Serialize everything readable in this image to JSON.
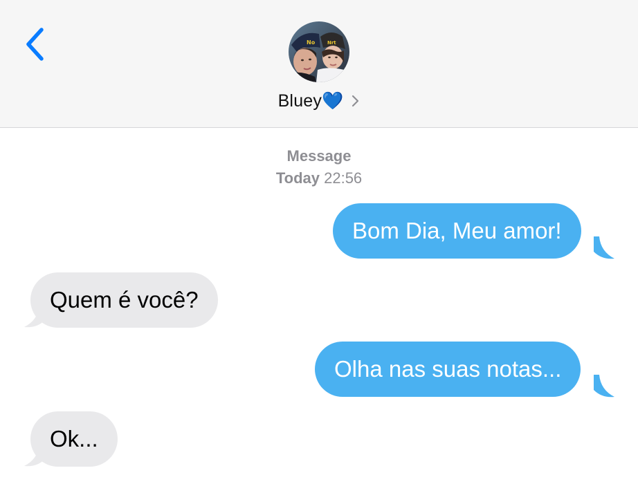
{
  "header": {
    "back_icon": "chevron-left-icon",
    "contact_name": "Bluey💙",
    "contact_chevron": "chevron-right-icon"
  },
  "conversation": {
    "service_label": "Message",
    "day_label": "Today",
    "time_label": "22:56"
  },
  "messages": [
    {
      "direction": "outgoing",
      "text": "Bom Dia, Meu amor!"
    },
    {
      "direction": "incoming",
      "text": "Quem é você?"
    },
    {
      "direction": "outgoing",
      "text": "Olha nas suas notas..."
    },
    {
      "direction": "incoming",
      "text": "Ok..."
    }
  ],
  "colors": {
    "accent": "#0a7cff",
    "outgoing_bubble": "#4ab1f1",
    "incoming_bubble": "#e9e9eb",
    "header_bg": "#f6f6f6",
    "timestamp": "#8e8e93"
  }
}
